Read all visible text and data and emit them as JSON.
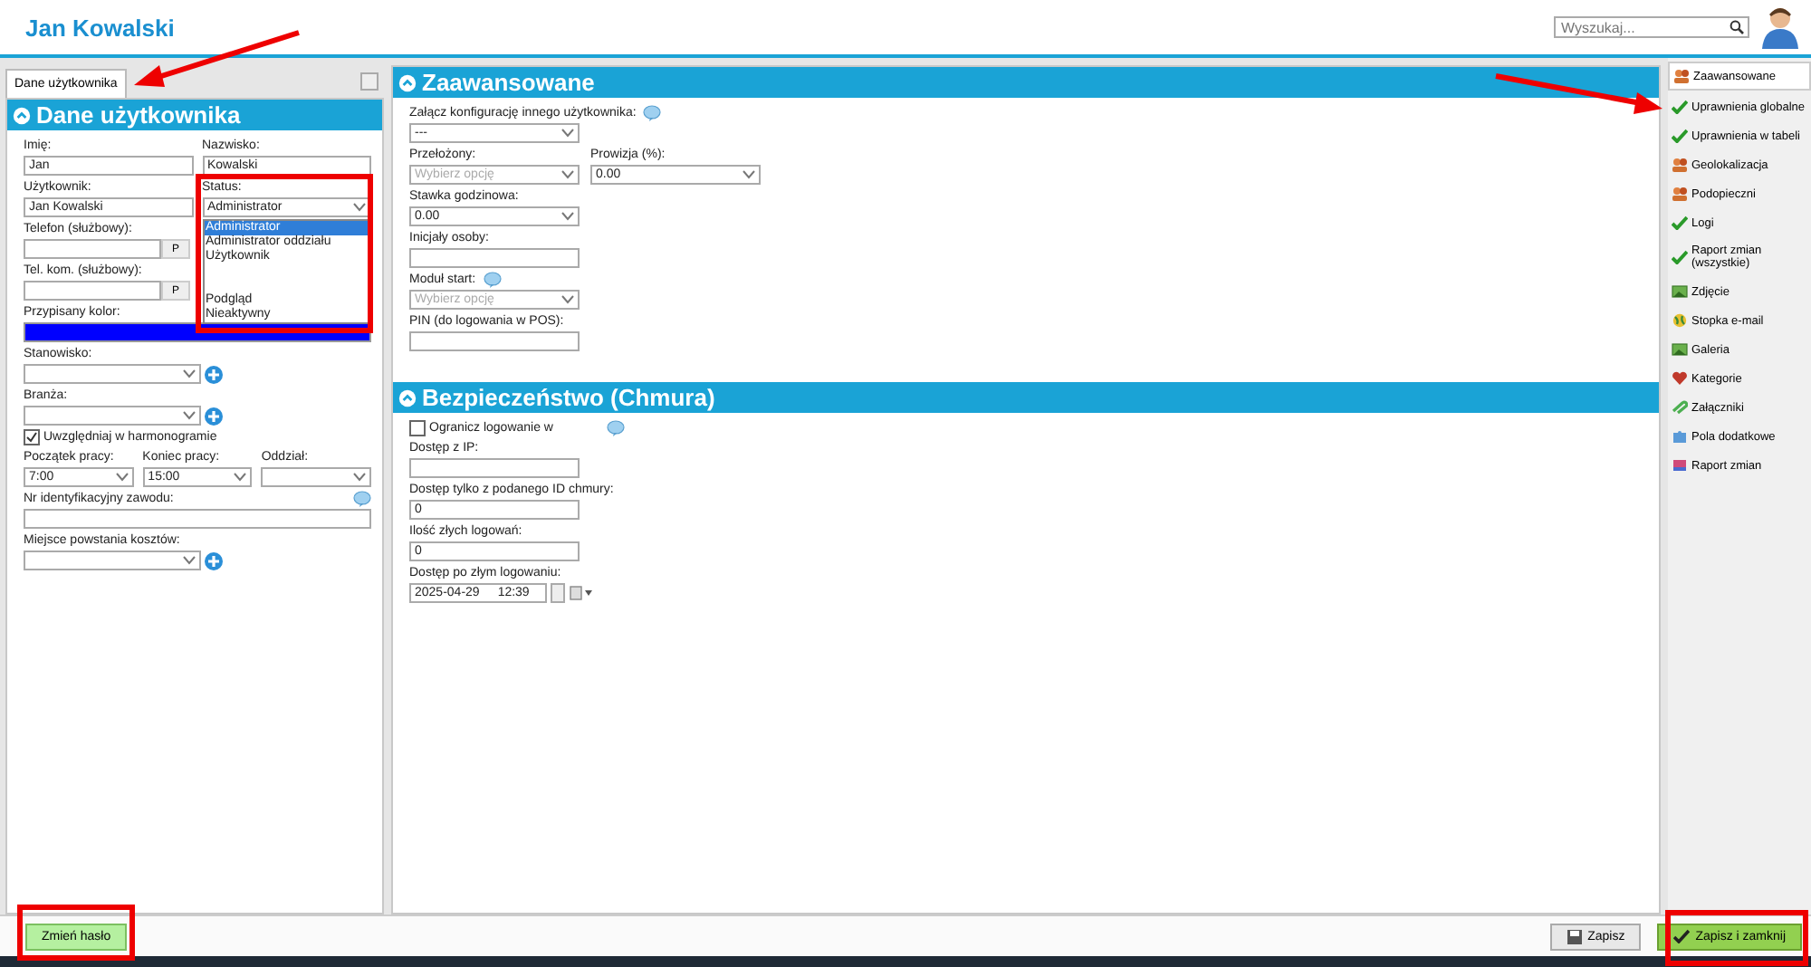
{
  "header": {
    "title": "Jan Kowalski",
    "search": {
      "placeholder": "Wyszukaj..."
    }
  },
  "left_tabs": [
    {
      "label": "Dane użytkownika",
      "selected": true
    }
  ],
  "user_section": {
    "title": "Dane użytkownika",
    "rows": [
      [
        {
          "kind": "text",
          "label": "Imię:",
          "value": "Jan"
        },
        {
          "kind": "text",
          "label": "Nazwisko:",
          "value": "Kowalski"
        }
      ],
      [
        {
          "kind": "text",
          "label": "Użytkownik:",
          "value": "Jan Kowalski"
        },
        {
          "kind": "select_open",
          "label": "Status:",
          "value": "Administrator"
        }
      ],
      [
        {
          "kind": "phone",
          "label": "Telefon (służbowy):",
          "button": "P"
        }
      ],
      [
        {
          "kind": "phone",
          "label": "Tel. kom. (służbowy):",
          "button": "P"
        }
      ],
      [
        {
          "kind": "color",
          "label": "Przypisany kolor:",
          "color": "#0000ff"
        }
      ],
      [
        {
          "kind": "select_add",
          "label": "Stanowisko:"
        }
      ],
      [
        {
          "kind": "select_add",
          "label": "Branża:"
        }
      ],
      [
        {
          "kind": "checkbox",
          "label": "Uwzględniaj w harmonogramie",
          "checked": true
        }
      ],
      [
        {
          "kind": "select",
          "label": "Początek pracy:",
          "value": "7:00"
        },
        {
          "kind": "select",
          "label": "Koniec pracy:",
          "value": "15:00"
        },
        {
          "kind": "select",
          "label": "Oddział:"
        }
      ],
      [
        {
          "kind": "text",
          "label": "Nr identyfikacyjny zawodu:",
          "info": true
        }
      ],
      [
        {
          "kind": "select_add",
          "label": "Miejsce powstania kosztów:"
        }
      ]
    ],
    "status_dropdown": {
      "options": [
        {
          "kind": "option",
          "label": "Administrator",
          "selected": true
        },
        {
          "kind": "option",
          "label": "Administrator oddziału",
          "selected": false
        },
        {
          "kind": "option",
          "label": "Użytkownik",
          "selected": false
        },
        {
          "kind": "spacer"
        },
        {
          "kind": "spacer"
        },
        {
          "kind": "option",
          "label": "Podgląd",
          "selected": false
        },
        {
          "kind": "option",
          "label": "Nieaktywny",
          "selected": false
        }
      ]
    }
  },
  "advanced_section": {
    "title": "Zaawansowane",
    "rows": [
      [
        {
          "kind": "select",
          "label": "Załącz konfigurację innego użytkownika:",
          "value": "---",
          "info": true
        }
      ],
      [
        {
          "kind": "select",
          "label": "Przełożony:",
          "placeholder": "Wybierz opcję"
        },
        {
          "kind": "select",
          "label": "Prowizja (%):",
          "value": "0.00"
        }
      ],
      [
        {
          "kind": "select",
          "label": "Stawka godzinowa:",
          "value": "0.00"
        }
      ],
      [
        {
          "kind": "text",
          "label": "Inicjały osoby:"
        }
      ],
      [
        {
          "kind": "select",
          "label": "Moduł start:",
          "placeholder": "Wybierz opcję",
          "info": true
        }
      ],
      [
        {
          "kind": "text",
          "label": "PIN (do logowania w POS):"
        }
      ]
    ]
  },
  "security_section": {
    "title": "Bezpieczeństwo (Chmura)",
    "rows": [
      [
        {
          "kind": "checkbox",
          "label": "Ogranicz logowanie w",
          "checked": false,
          "info": true
        }
      ],
      [
        {
          "kind": "text",
          "label": "Dostęp z IP:"
        }
      ],
      [
        {
          "kind": "text",
          "label": "Dostęp tylko z podanego ID chmury:",
          "value": "0"
        }
      ],
      [
        {
          "kind": "text",
          "label": "Ilość złych logowań:",
          "value": "0"
        }
      ],
      [
        {
          "kind": "datetime",
          "label": "Dostęp po złym logowaniu:",
          "date": "2025-04-29",
          "time": "12:39"
        }
      ]
    ]
  },
  "sidebar": {
    "items": [
      {
        "label": "Zaawansowane",
        "kind": "people",
        "selected": true
      },
      {
        "label": "Uprawnienia globalne",
        "kind": "check",
        "selected": false
      },
      {
        "label": "Uprawnienia w tabeli",
        "kind": "check",
        "selected": false
      },
      {
        "label": "Geolokalizacja",
        "kind": "people",
        "selected": false
      },
      {
        "label": "Podopieczni",
        "kind": "people",
        "selected": false
      },
      {
        "label": "Logi",
        "kind": "check",
        "selected": false
      },
      {
        "label": "Raport zmian (wszystkie)",
        "kind": "check",
        "selected": false
      },
      {
        "label": "Zdjęcie",
        "kind": "photo",
        "selected": false
      },
      {
        "label": "Stopka e-mail",
        "kind": "globe",
        "selected": false
      },
      {
        "label": "Galeria",
        "kind": "photo",
        "selected": false
      },
      {
        "label": "Kategorie",
        "kind": "heart",
        "selected": false
      },
      {
        "label": "Załączniki",
        "kind": "clip",
        "selected": false
      },
      {
        "label": "Pola dodatkowe",
        "kind": "puzzle",
        "selected": false
      },
      {
        "label": "Raport zmian",
        "kind": "book",
        "selected": false
      }
    ]
  },
  "footer": {
    "buttons": [
      {
        "label": "Zmień hasło",
        "kind": "green"
      },
      {
        "label": "Zapisz",
        "kind": "save"
      },
      {
        "label": "Zapisz i zamknij",
        "kind": "save_close"
      }
    ]
  }
}
